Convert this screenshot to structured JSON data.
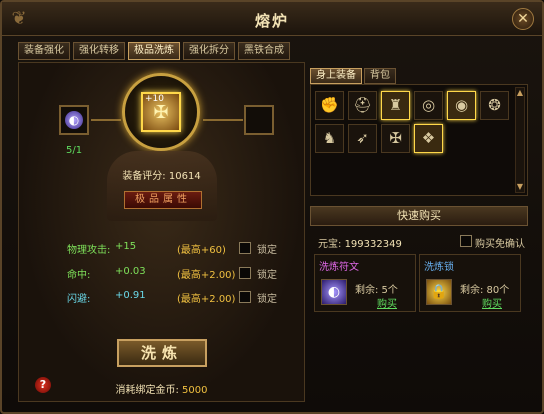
{
  "window": {
    "title": "熔炉",
    "close_glyph": "✕"
  },
  "tabs": [
    {
      "label": "装备强化"
    },
    {
      "label": "强化转移"
    },
    {
      "label": "极品洗炼",
      "active": true
    },
    {
      "label": "强化拆分"
    },
    {
      "label": "黑铁合成"
    }
  ],
  "refine": {
    "item_plus": "+10",
    "slot_count": "5/1",
    "score_label": "装备评分:",
    "score_value": "10614",
    "quality_button": "极品属性",
    "stats": [
      {
        "name": "物理攻击:",
        "value": "+15",
        "max": "(最高+60)",
        "lock": "锁定",
        "color": "green"
      },
      {
        "name": "命中:",
        "value": "+0.03",
        "max": "(最高+2.00)",
        "lock": "锁定",
        "color": "green"
      },
      {
        "name": "闪避:",
        "value": "+0.91",
        "max": "(最高+2.00)",
        "lock": "锁定",
        "color": "cyan"
      }
    ],
    "refine_button": "洗炼",
    "cost_label": "消耗绑定金币:",
    "cost_value": "5000",
    "help_glyph": "?"
  },
  "inventory": {
    "tabs": [
      {
        "label": "身上装备",
        "active": true
      },
      {
        "label": "背包"
      }
    ],
    "items": [
      {
        "icon": "glove-icon",
        "glyph": "✊",
        "highlighted": false
      },
      {
        "icon": "helmet-icon",
        "glyph": "⛑",
        "highlighted": false
      },
      {
        "icon": "armor-icon",
        "glyph": "♜",
        "highlighted": true
      },
      {
        "icon": "ring-icon",
        "glyph": "◎",
        "highlighted": false
      },
      {
        "icon": "ring-purple-icon",
        "glyph": "◉",
        "highlighted": true
      },
      {
        "icon": "necklace-icon",
        "glyph": "❂",
        "highlighted": false
      },
      {
        "icon": "boots-icon",
        "glyph": "♞",
        "highlighted": false
      },
      {
        "icon": "bracer-icon",
        "glyph": "➶",
        "highlighted": false
      },
      {
        "icon": "weapon-icon",
        "glyph": "✠",
        "highlighted": false
      },
      {
        "icon": "amulet-icon",
        "glyph": "❖",
        "highlighted": true
      }
    ]
  },
  "quick_buy": {
    "title": "快速购买",
    "yuanbao_label": "元宝:",
    "yuanbao_value": "199332349",
    "confirm_label": "购买免确认",
    "cards": [
      {
        "title": "洗炼符文",
        "remain": "剩余: 5个",
        "buy": "购买",
        "icon": "rune-orb-icon",
        "glyph": "◐"
      },
      {
        "title": "洗炼锁",
        "remain": "剩余: 80个",
        "buy": "购买",
        "icon": "padlock-icon",
        "glyph": "🔒"
      }
    ]
  },
  "colors": {
    "accent_gold": "#f0c040",
    "stat_green": "#7ee05a",
    "stat_cyan": "#6ad8e8",
    "buy_green": "#5fdc5f"
  }
}
